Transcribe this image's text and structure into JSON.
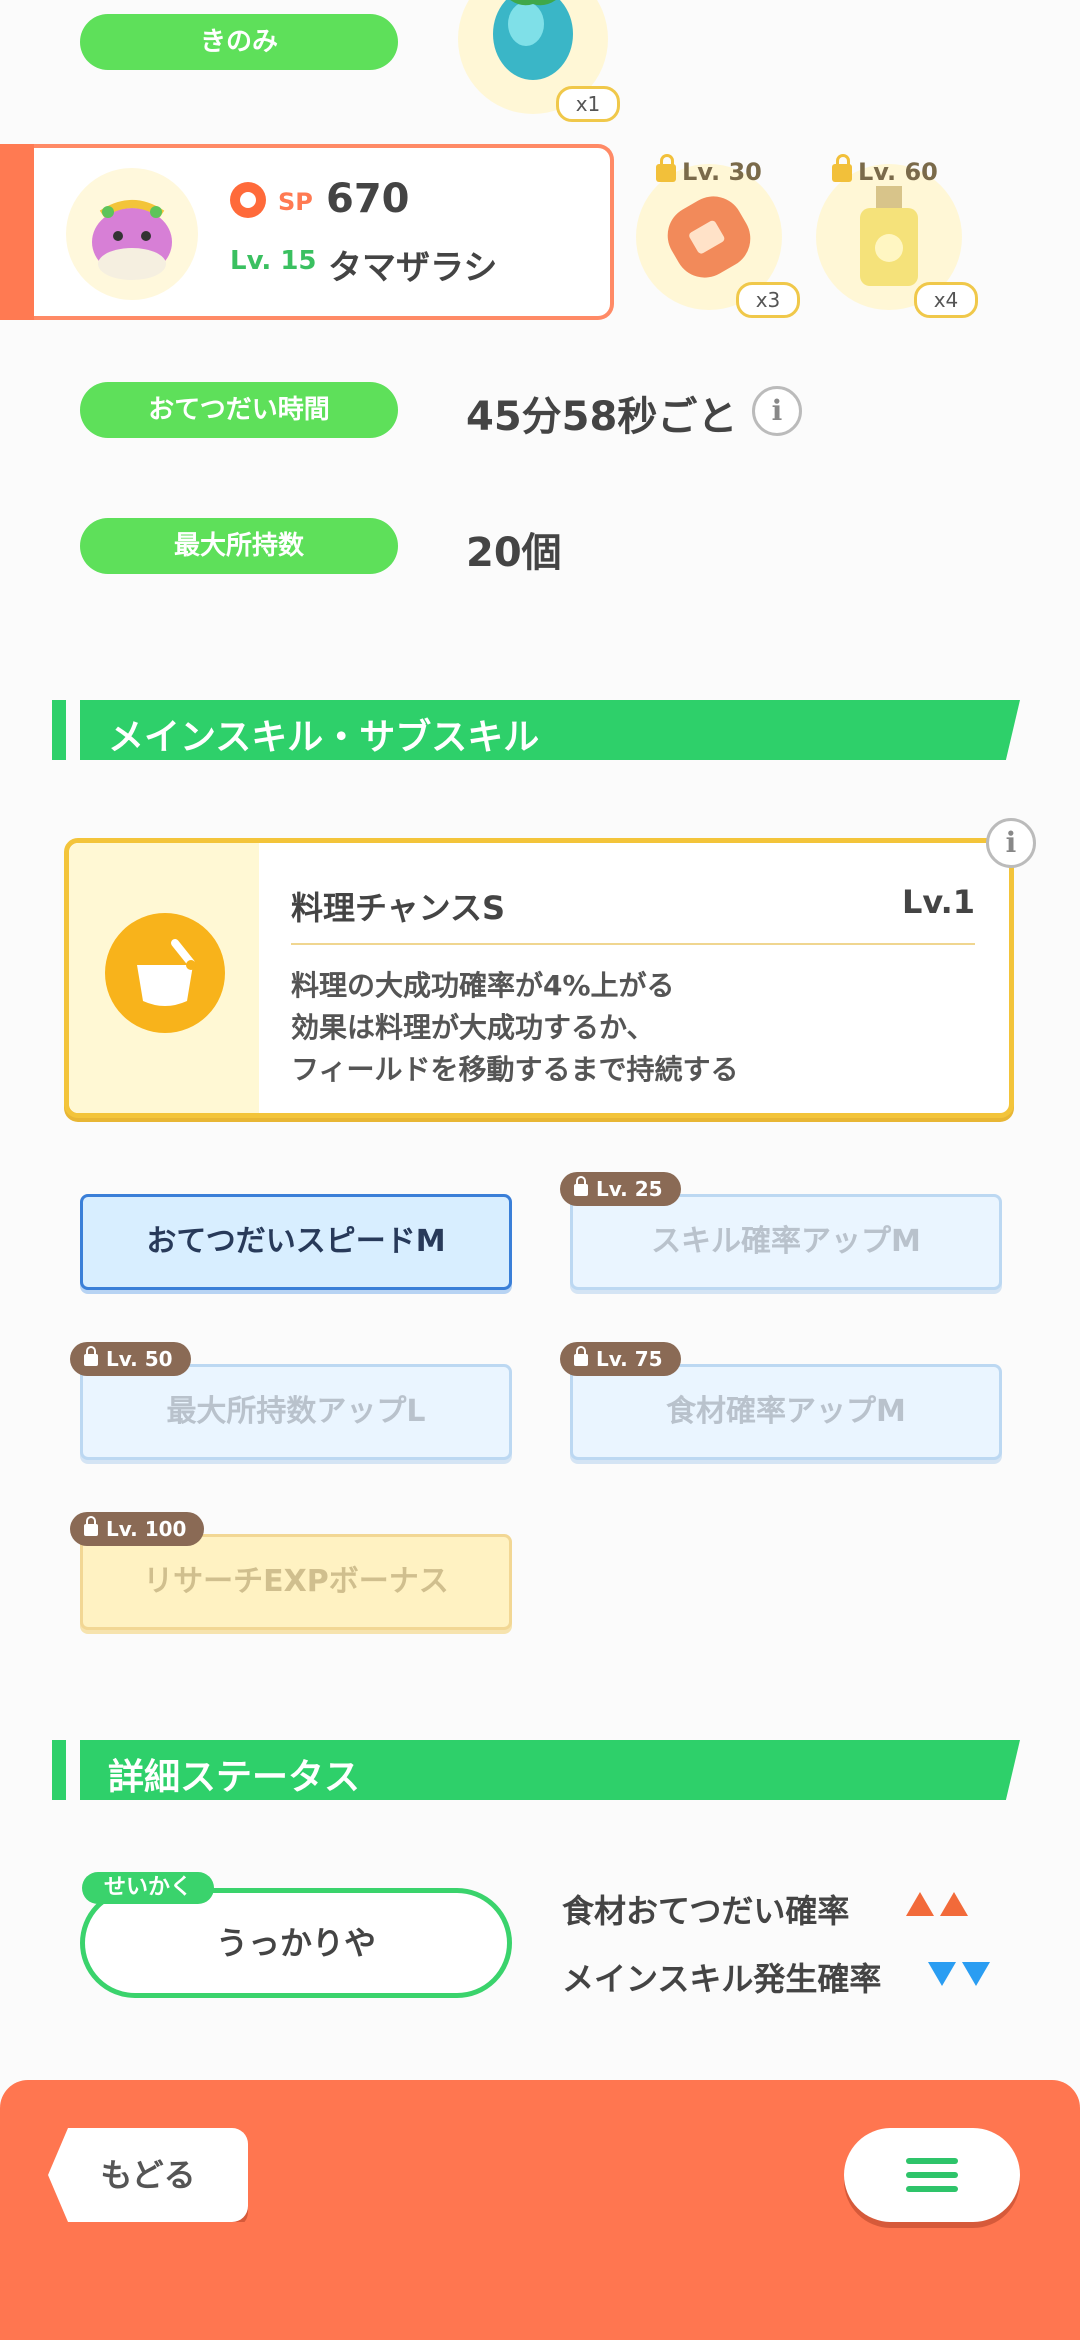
{
  "top": {
    "berry_label": "きのみ",
    "berry_count": "x1"
  },
  "pokemon": {
    "sp_label": "SP",
    "sp_value": "670",
    "level": "Lv. 15",
    "name": "タマザラシ"
  },
  "ingredients": [
    {
      "lock_level": "Lv. 30",
      "count": "x3",
      "icon": "sausage-icon"
    },
    {
      "lock_level": "Lv. 60",
      "count": "x4",
      "icon": "oil-bottle-icon"
    }
  ],
  "help_time": {
    "label": "おてつだい時間",
    "value": "45分58秒ごと"
  },
  "max_carry": {
    "label": "最大所持数",
    "value": "20個"
  },
  "sections": {
    "skills_title": "メインスキル・サブスキル",
    "details_title": "詳細ステータス"
  },
  "main_skill": {
    "name": "料理チャンスS",
    "level": "Lv.1",
    "desc1": "料理の大成功確率が4%上がる",
    "desc2": "効果は料理が大成功するか、",
    "desc3": "フィールドを移動するまで持続する"
  },
  "sub_skills": [
    {
      "label": "おてつだいスピードM",
      "lock": ""
    },
    {
      "label": "スキル確率アップM",
      "lock": "Lv. 25"
    },
    {
      "label": "最大所持数アップL",
      "lock": "Lv. 50"
    },
    {
      "label": "食材確率アップM",
      "lock": "Lv. 75"
    },
    {
      "label": "リサーチEXPボーナス",
      "lock": "Lv. 100"
    }
  ],
  "nature": {
    "tag": "せいかく",
    "value": "うっかりや",
    "up_label": "食材おてつだい確率",
    "down_label": "メインスキル発生確率"
  },
  "nav": {
    "back_label": "もどる"
  },
  "colors": {
    "green": "#2ed06a",
    "orange": "#ff7650",
    "gold": "#f3c43a"
  }
}
